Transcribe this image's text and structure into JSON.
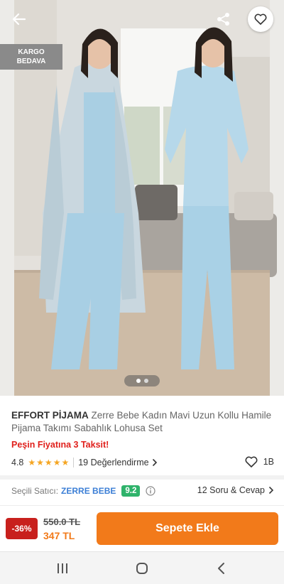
{
  "hero": {
    "cargo_badge_line1": "KARGO",
    "cargo_badge_line2": "BEDAVA",
    "pager": {
      "count": 2,
      "active": 0
    }
  },
  "icons": {
    "back": "back-arrow-icon",
    "share": "share-icon",
    "favorite": "heart-icon",
    "info": "info-icon"
  },
  "product": {
    "brand": "EFFORT PİJAMA",
    "name": "Zerre Bebe Kadın Mavi Uzun Kollu Hamile Pijama Takımı Sabahlık Lohusa Set",
    "promo": "Peşin Fiyatına 3 Taksit!",
    "rating": "4.8",
    "stars": 5,
    "reviews_label": "19 Değerlendirme",
    "likes": "1B"
  },
  "seller": {
    "label": "Seçili Satıcı:",
    "name": "ZERRE BEBE",
    "score": "9.2",
    "qa_label": "12 Soru & Cevap"
  },
  "price": {
    "discount": "-36%",
    "old": "550.0 TL",
    "new": "347 TL",
    "add_to_cart": "Sepete Ekle"
  },
  "colors": {
    "accent": "#f27a1a",
    "discount_bg": "#c8201d",
    "promo_text": "#e0201c",
    "seller_link": "#3c7fd6",
    "seller_score_bg": "#2fb36b",
    "star": "#f5a623"
  },
  "system_nav": [
    "recent-apps-icon",
    "home-icon",
    "back-icon"
  ]
}
